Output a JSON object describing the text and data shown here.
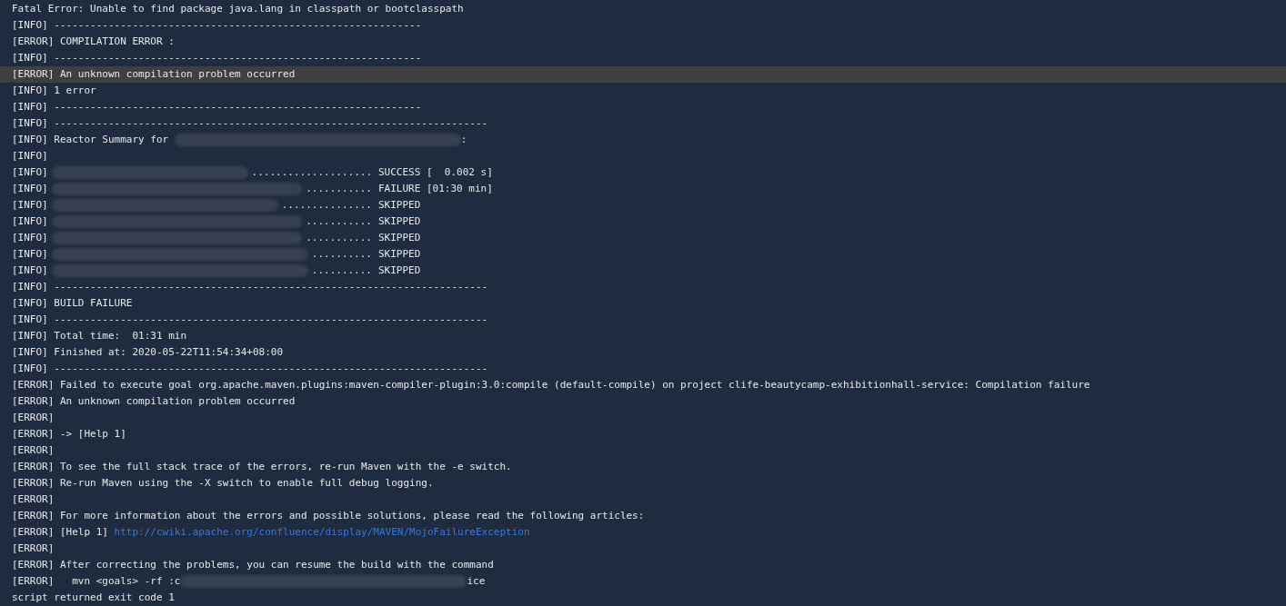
{
  "lines": [
    {
      "kind": "text",
      "text": "Fatal Error: Unable to find package java.lang in classpath or bootclasspath"
    },
    {
      "kind": "text",
      "text": "[INFO] -------------------------------------------------------------"
    },
    {
      "kind": "text",
      "text": "[ERROR] COMPILATION ERROR :"
    },
    {
      "kind": "text",
      "text": "[INFO] -------------------------------------------------------------"
    },
    {
      "kind": "text",
      "text": "[ERROR] An unknown compilation problem occurred",
      "highlighted": true
    },
    {
      "kind": "text",
      "text": "[INFO] 1 error"
    },
    {
      "kind": "text",
      "text": "[INFO] -------------------------------------------------------------"
    },
    {
      "kind": "text",
      "text": "[INFO] ------------------------------------------------------------------------"
    },
    {
      "kind": "redacted",
      "before": "[INFO] Reactor Summary for ",
      "after": ":"
    },
    {
      "kind": "text",
      "text": "[INFO]"
    },
    {
      "kind": "module",
      "prefix": "[INFO]",
      "dots": "....................",
      "status": "SUCCESS [  0.002 s]"
    },
    {
      "kind": "module",
      "prefix": "[INFO]",
      "dots": "...........",
      "status": "FAILURE [01:30 min]"
    },
    {
      "kind": "module",
      "prefix": "[INFO]",
      "dots": "...............",
      "status": "SKIPPED"
    },
    {
      "kind": "module",
      "prefix": "[INFO]",
      "dots": "...........",
      "status": "SKIPPED"
    },
    {
      "kind": "module",
      "prefix": "[INFO]",
      "dots": "...........",
      "status": "SKIPPED"
    },
    {
      "kind": "module",
      "prefix": "[INFO]",
      "dots": "..........",
      "status": "SKIPPED"
    },
    {
      "kind": "module",
      "prefix": "[INFO]",
      "dots": "..........",
      "status": "SKIPPED"
    },
    {
      "kind": "text",
      "text": "[INFO] ------------------------------------------------------------------------"
    },
    {
      "kind": "text",
      "text": "[INFO] BUILD FAILURE"
    },
    {
      "kind": "text",
      "text": "[INFO] ------------------------------------------------------------------------"
    },
    {
      "kind": "text",
      "text": "[INFO] Total time:  01:31 min"
    },
    {
      "kind": "text",
      "text": "[INFO] Finished at: 2020-05-22T11:54:34+08:00"
    },
    {
      "kind": "text",
      "text": "[INFO] ------------------------------------------------------------------------"
    },
    {
      "kind": "text",
      "text": "[ERROR] Failed to execute goal org.apache.maven.plugins:maven-compiler-plugin:3.0:compile (default-compile) on project clife-beautycamp-exhibitionhall-service: Compilation failure"
    },
    {
      "kind": "text",
      "text": "[ERROR] An unknown compilation problem occurred"
    },
    {
      "kind": "text",
      "text": "[ERROR]"
    },
    {
      "kind": "text",
      "text": "[ERROR] -> [Help 1]"
    },
    {
      "kind": "text",
      "text": "[ERROR]"
    },
    {
      "kind": "text",
      "text": "[ERROR] To see the full stack trace of the errors, re-run Maven with the -e switch."
    },
    {
      "kind": "text",
      "text": "[ERROR] Re-run Maven using the -X switch to enable full debug logging."
    },
    {
      "kind": "text",
      "text": "[ERROR]"
    },
    {
      "kind": "text",
      "text": "[ERROR] For more information about the errors and possible solutions, please read the following articles:"
    },
    {
      "kind": "link",
      "before": "[ERROR] [Help 1] ",
      "link": "http://cwiki.apache.org/confluence/display/MAVEN/MojoFailureException"
    },
    {
      "kind": "text",
      "text": "[ERROR]"
    },
    {
      "kind": "text",
      "text": "[ERROR] After correcting the problems, you can resume the build with the command"
    },
    {
      "kind": "redacted",
      "before": "[ERROR]   mvn <goals> -rf :c",
      "after": "ice"
    },
    {
      "kind": "text",
      "text": "script returned exit code 1"
    }
  ]
}
